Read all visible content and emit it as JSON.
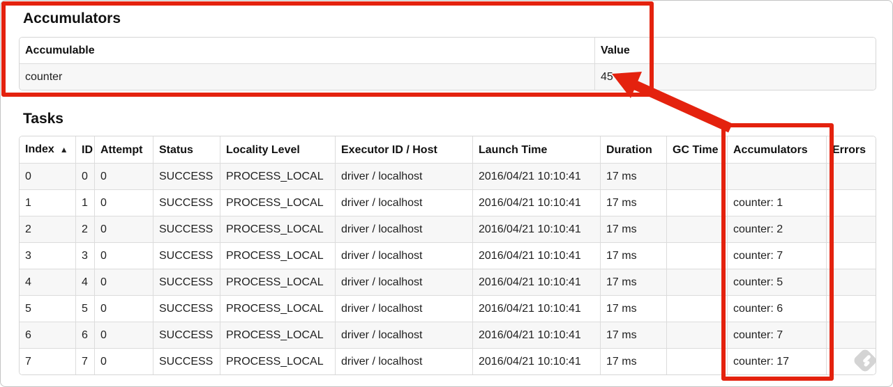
{
  "colors": {
    "annotation_red": "#e4220e"
  },
  "accumulators_section": {
    "heading": "Accumulators",
    "table": {
      "headers": [
        "Accumulable",
        "Value"
      ],
      "rows": [
        [
          "counter",
          "45"
        ]
      ]
    }
  },
  "tasks_section": {
    "heading": "Tasks",
    "table": {
      "headers": [
        "Index",
        "ID",
        "Attempt",
        "Status",
        "Locality Level",
        "Executor ID / Host",
        "Launch Time",
        "Duration",
        "GC Time",
        "Accumulators",
        "Errors"
      ],
      "sort": {
        "column": "Index",
        "direction": "ascending",
        "icon": "▲"
      },
      "rows": [
        [
          "0",
          "0",
          "0",
          "SUCCESS",
          "PROCESS_LOCAL",
          "driver / localhost",
          "2016/04/21 10:10:41",
          "17 ms",
          "",
          "",
          ""
        ],
        [
          "1",
          "1",
          "0",
          "SUCCESS",
          "PROCESS_LOCAL",
          "driver / localhost",
          "2016/04/21 10:10:41",
          "17 ms",
          "",
          "counter: 1",
          ""
        ],
        [
          "2",
          "2",
          "0",
          "SUCCESS",
          "PROCESS_LOCAL",
          "driver / localhost",
          "2016/04/21 10:10:41",
          "17 ms",
          "",
          "counter: 2",
          ""
        ],
        [
          "3",
          "3",
          "0",
          "SUCCESS",
          "PROCESS_LOCAL",
          "driver / localhost",
          "2016/04/21 10:10:41",
          "17 ms",
          "",
          "counter: 7",
          ""
        ],
        [
          "4",
          "4",
          "0",
          "SUCCESS",
          "PROCESS_LOCAL",
          "driver / localhost",
          "2016/04/21 10:10:41",
          "17 ms",
          "",
          "counter: 5",
          ""
        ],
        [
          "5",
          "5",
          "0",
          "SUCCESS",
          "PROCESS_LOCAL",
          "driver / localhost",
          "2016/04/21 10:10:41",
          "17 ms",
          "",
          "counter: 6",
          ""
        ],
        [
          "6",
          "6",
          "0",
          "SUCCESS",
          "PROCESS_LOCAL",
          "driver / localhost",
          "2016/04/21 10:10:41",
          "17 ms",
          "",
          "counter: 7",
          ""
        ],
        [
          "7",
          "7",
          "0",
          "SUCCESS",
          "PROCESS_LOCAL",
          "driver / localhost",
          "2016/04/21 10:10:41",
          "17 ms",
          "",
          "counter: 17",
          ""
        ]
      ]
    }
  }
}
